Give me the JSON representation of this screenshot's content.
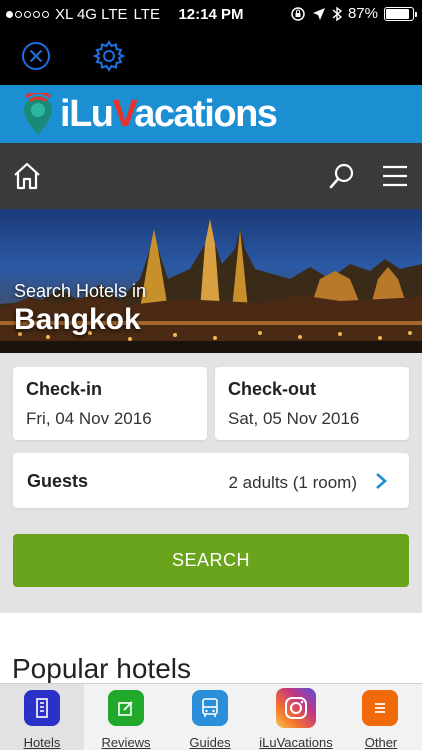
{
  "status_bar": {
    "carrier": "XL 4G LTE",
    "network": "LTE",
    "time": "12:14 PM",
    "battery": "87%",
    "battery_level": 0.87
  },
  "top_toolbar": {
    "close_icon": "close-circle-icon",
    "settings_icon": "gear-icon",
    "icon_color": "#1e6fe0"
  },
  "brand": {
    "name_part1": "i",
    "name_part2": "Lu",
    "name_part3": "V",
    "name_part4": "acations",
    "banner_color": "#1b8fd2",
    "accent_color": "#e8322a"
  },
  "nav": {
    "home_icon": "home-icon",
    "search_icon": "search-icon",
    "menu_icon": "menu-icon"
  },
  "hero": {
    "subtitle": "Search Hotels in",
    "city": "Bangkok"
  },
  "booking": {
    "checkin_label": "Check-in",
    "checkin_value": "Fri, 04 Nov 2016",
    "checkout_label": "Check-out",
    "checkout_value": "Sat, 05 Nov 2016",
    "guests_label": "Guests",
    "guests_value": "2 adults (1 room)",
    "search_label": "SEARCH",
    "search_color": "#6aa31c"
  },
  "popular": {
    "title": "Popular hotels"
  },
  "tab_bar": {
    "tabs": [
      {
        "label": "Hotels",
        "icon": "hotel-icon",
        "color": "#2a30c8",
        "active": true
      },
      {
        "label": "Reviews",
        "icon": "review-edit-icon",
        "color": "#22a82a",
        "active": false
      },
      {
        "label": "Guides",
        "icon": "bus-icon",
        "color": "#2a8ed8",
        "active": false
      },
      {
        "label": "iLuVacations",
        "icon": "instagram-icon",
        "color": "#c13584",
        "active": false
      },
      {
        "label": "Other",
        "icon": "list-icon",
        "color": "#f06a0a",
        "active": false
      }
    ]
  }
}
